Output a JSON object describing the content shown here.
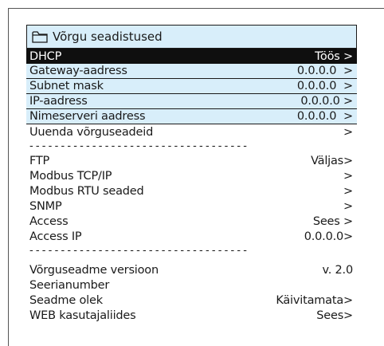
{
  "screen": {
    "title": "Võrgu seadistused",
    "title_icon": "folder-icon",
    "separator": "-----------------------------------"
  },
  "network": [
    {
      "label": "DHCP",
      "value": "Töös >"
    },
    {
      "label": "Gateway-aadress",
      "value": "0.0.0.0  >"
    },
    {
      "label": "Subnet mask",
      "value": "0.0.0.0  >"
    },
    {
      "label": "IP-aadress",
      "value": "0.0.0.0 >"
    },
    {
      "label": "Nimeserveri aadress",
      "value": "0.0.0.0  >"
    },
    {
      "label": "Uuenda võrguseadeid",
      "value": ">"
    }
  ],
  "protocols": [
    {
      "label": "FTP",
      "value": "Väljas>"
    },
    {
      "label": "Modbus TCP/IP",
      "value": ">"
    },
    {
      "label": "Modbus RTU seaded",
      "value": ">"
    },
    {
      "label": "SNMP",
      "value": ">"
    },
    {
      "label": "Access",
      "value": "Sees >"
    },
    {
      "label": "Access IP",
      "value": "0.0.0.0>"
    }
  ],
  "device": [
    {
      "label": "Võrguseadme versioon",
      "value": "v. 2.0"
    },
    {
      "label": "Seerianumber",
      "value": ""
    },
    {
      "label": "Seadme olek",
      "value": "Käivitamata>"
    },
    {
      "label": "WEB kasutajaliides",
      "value": "Sees>"
    }
  ]
}
